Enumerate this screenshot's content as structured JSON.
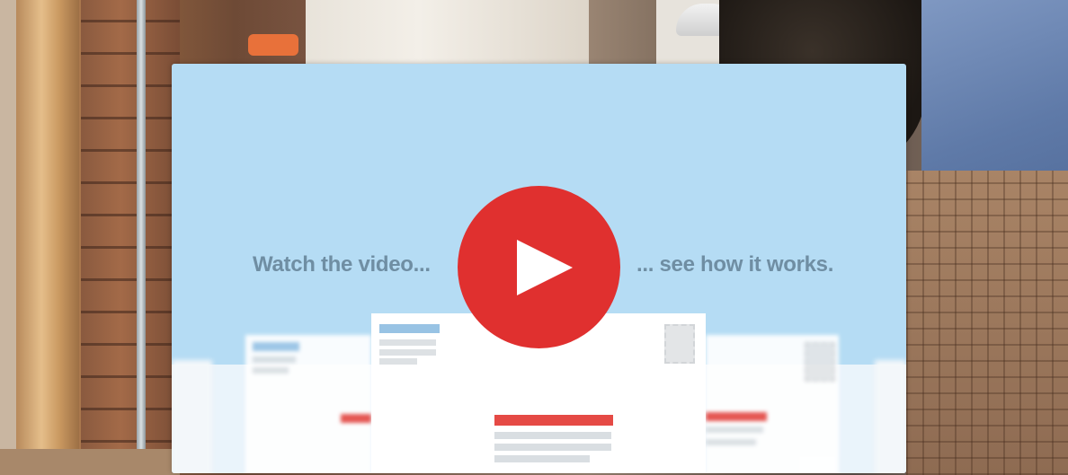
{
  "video_promo": {
    "caption_left": "Watch the video...",
    "caption_right": "... see how it works.",
    "play_icon": "play-icon",
    "colors": {
      "card_background": "#b5dcf4",
      "play_button": "#e0302f",
      "caption_text": "#6f8ea3"
    }
  }
}
